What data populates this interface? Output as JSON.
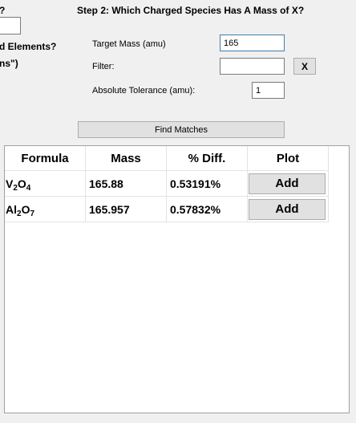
{
  "left_panel": {
    "question_fragment": "?",
    "line1": "d Elements?",
    "line2": "ns\")"
  },
  "step2": {
    "title": "Step 2: Which Charged Species Has A Mass of X?",
    "target_mass_label": "Target Mass (amu)",
    "target_mass_value": "165",
    "filter_label": "Filter:",
    "filter_value": "",
    "clear_filter_label": "X",
    "tolerance_label": "Absolute Tolerance (amu):",
    "tolerance_value": "1",
    "find_button_label": "Find Matches"
  },
  "results": {
    "columns": [
      "Formula",
      "Mass",
      "% Diff.",
      "Plot"
    ],
    "rows": [
      {
        "formula_parts": [
          {
            "el": "V",
            "n": "2"
          },
          {
            "el": "O",
            "n": "4"
          }
        ],
        "mass": "165.88",
        "diff": "0.53191%",
        "plot_label": "Add"
      },
      {
        "formula_parts": [
          {
            "el": "Al",
            "n": "2"
          },
          {
            "el": "O",
            "n": "7"
          }
        ],
        "mass": "165.957",
        "diff": "0.57832%",
        "plot_label": "Add"
      }
    ]
  }
}
